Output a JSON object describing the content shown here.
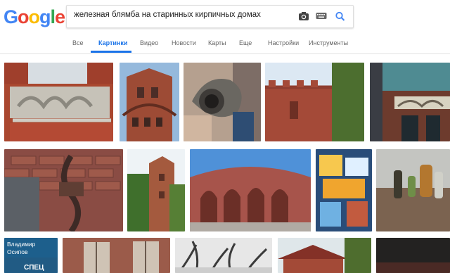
{
  "logo": {
    "letters": [
      "G",
      "o",
      "o",
      "g",
      "l",
      "e"
    ]
  },
  "search": {
    "query": "железная блямба на старинных кирпичных домах"
  },
  "tabs": [
    {
      "label": "Все"
    },
    {
      "label": "Картинки"
    },
    {
      "label": "Видео"
    },
    {
      "label": "Новости"
    },
    {
      "label": "Карты"
    },
    {
      "label": "Еще"
    },
    {
      "label": "Настройки"
    },
    {
      "label": "Инструменты"
    }
  ],
  "results": [
    {
      "label": "ornamental façade"
    },
    {
      "label": "brick tower with windows"
    },
    {
      "label": "rusty iron hook held in hands"
    },
    {
      "label": "brick turret against sky"
    },
    {
      "label": "decorated Art Nouveau façade"
    },
    {
      "label": "brick wall with iron hook"
    },
    {
      "label": "brick tower in greenery"
    },
    {
      "label": "circular brick ruins"
    },
    {
      "label": "travel posters"
    },
    {
      "label": "old bottles on ground"
    },
    {
      "label": "Владимир Осипов СПЕЦ"
    },
    {
      "label": "old wooden windows"
    },
    {
      "label": "winter trees"
    },
    {
      "label": "brick house with roof"
    },
    {
      "label": "dark brick"
    }
  ],
  "book_overlay": {
    "author_first": "Владимир",
    "author_last": "Осипов",
    "series": "СПЕЦ"
  },
  "colors": {
    "accent": "#1a73e8",
    "logo_blue": "#4285f4",
    "logo_red": "#ea4335",
    "logo_yellow": "#fbbc05",
    "logo_green": "#34a853"
  }
}
